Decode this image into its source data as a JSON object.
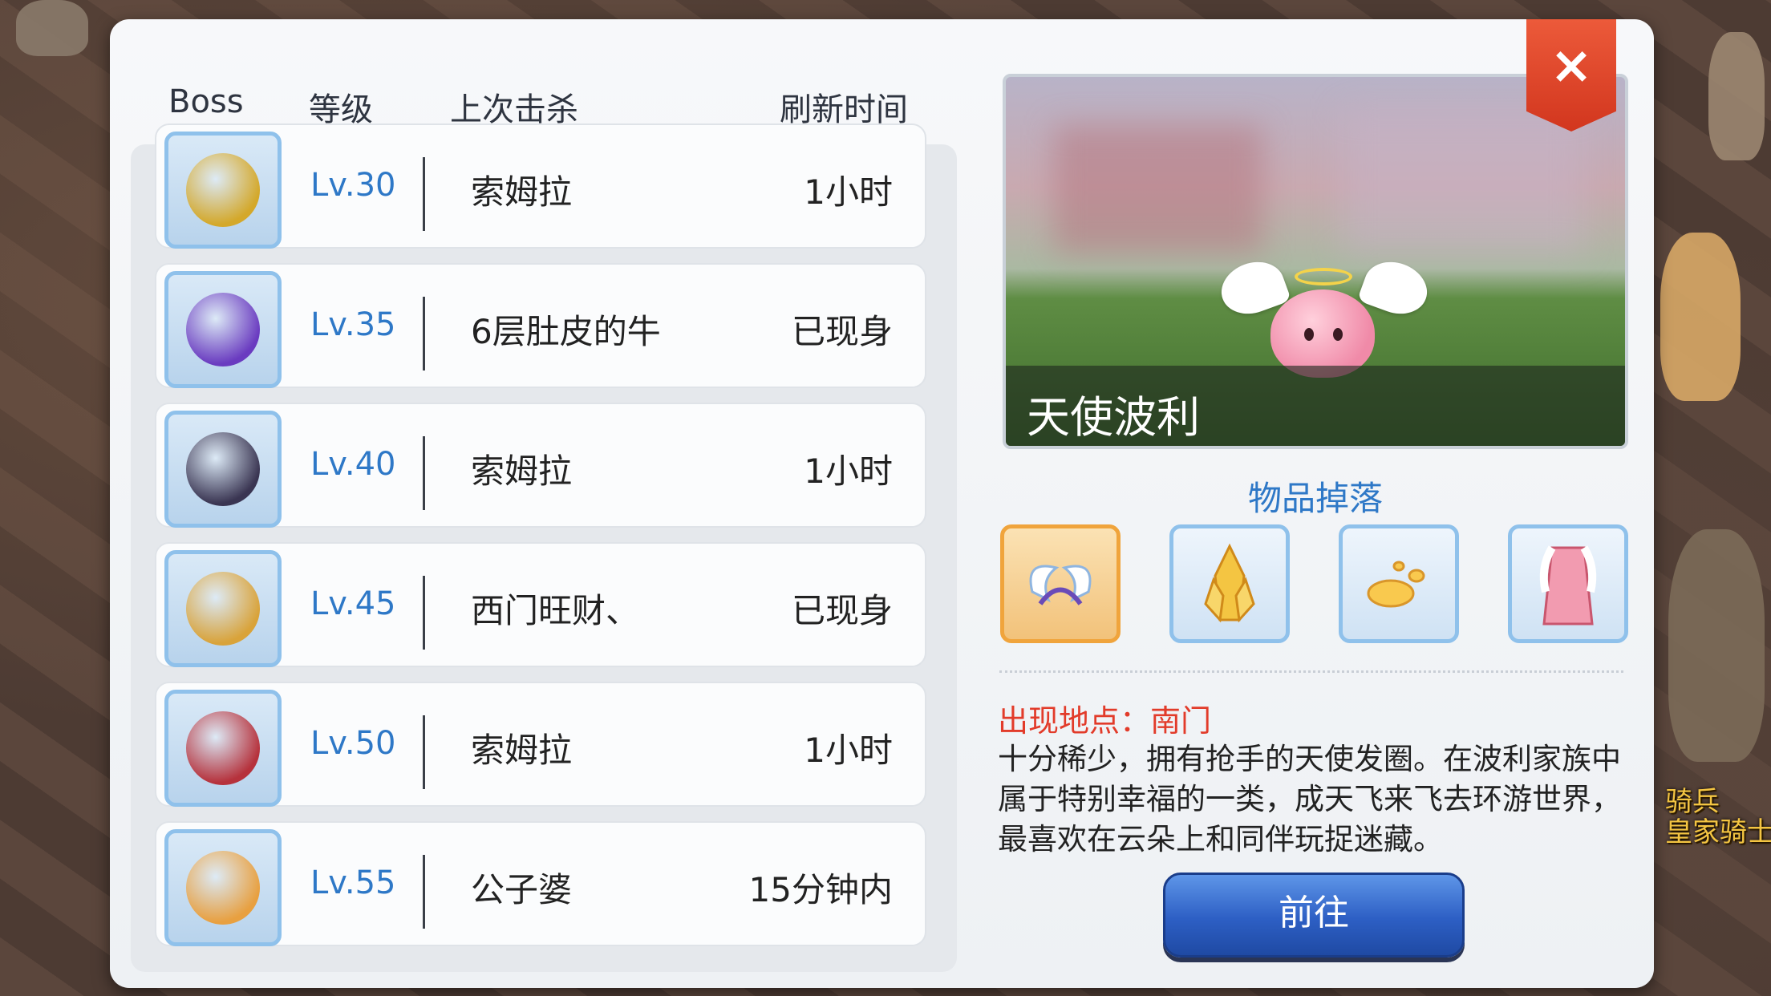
{
  "headers": {
    "boss": "Boss",
    "level": "等级",
    "last_kill": "上次击杀",
    "refresh": "刷新时间"
  },
  "bosses": [
    {
      "level": "Lv.30",
      "last_kill": "索姆拉",
      "refresh": "1小时",
      "color": "#d4a82a"
    },
    {
      "level": "Lv.35",
      "last_kill": "6层肚皮的牛",
      "refresh": "已现身",
      "color": "#6a3bc0"
    },
    {
      "level": "Lv.40",
      "last_kill": "索姆拉",
      "refresh": "1小时",
      "color": "#3a3552"
    },
    {
      "level": "Lv.45",
      "last_kill": "西门旺财、",
      "refresh": "已现身",
      "color": "#d9a33a"
    },
    {
      "level": "Lv.50",
      "last_kill": "索姆拉",
      "refresh": "1小时",
      "color": "#b6323c"
    },
    {
      "level": "Lv.55",
      "last_kill": "公子婆",
      "refresh": "15分钟内",
      "color": "#e8a040"
    }
  ],
  "preview": {
    "name": "天使波利"
  },
  "drops": {
    "title": "物品掉落",
    "items": [
      {
        "icon": "angel-wing-headband-icon",
        "selected": true
      },
      {
        "icon": "crystal-icon",
        "selected": false
      },
      {
        "icon": "jellopy-icon",
        "selected": false
      },
      {
        "icon": "robe-icon",
        "selected": false
      }
    ]
  },
  "location": "出现地点：南门",
  "description": "十分稀少，拥有抢手的天使发圈。在波利家族中属于特别幸福的一类，成天飞来飞去环游世界，最喜欢在云朵上和同伴玩捉迷藏。",
  "go_button": "前往",
  "close_icon": "×",
  "bg_labels": {
    "line1": "骑兵",
    "line2": "皇家骑士"
  },
  "colors": {
    "accent_blue": "#2e78c7",
    "location_red": "#e23b2a",
    "close_red": "#d2361e"
  }
}
